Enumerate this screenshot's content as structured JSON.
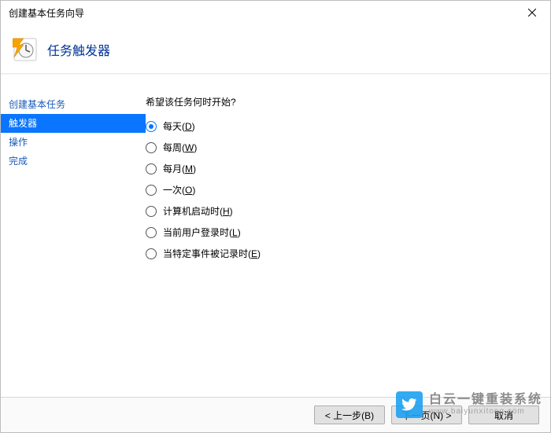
{
  "window": {
    "title": "创建基本任务向导"
  },
  "header": {
    "title": "任务触发器"
  },
  "sidebar": {
    "items": [
      {
        "label": "创建基本任务",
        "selected": false
      },
      {
        "label": "触发器",
        "selected": true
      },
      {
        "label": "操作",
        "selected": false
      },
      {
        "label": "完成",
        "selected": false
      }
    ]
  },
  "content": {
    "prompt": "希望该任务何时开始?",
    "options": [
      {
        "text": "每天",
        "accesskey": "D",
        "selected": true
      },
      {
        "text": "每周",
        "accesskey": "W",
        "selected": false
      },
      {
        "text": "每月",
        "accesskey": "M",
        "selected": false
      },
      {
        "text": "一次",
        "accesskey": "O",
        "selected": false
      },
      {
        "text": "计算机启动时",
        "accesskey": "H",
        "selected": false
      },
      {
        "text": "当前用户登录时",
        "accesskey": "L",
        "selected": false
      },
      {
        "text": "当特定事件被记录时",
        "accesskey": "E",
        "selected": false
      }
    ]
  },
  "footer": {
    "back": "< 上一步(B)",
    "next": "下一页(N) >",
    "cancel": "取消"
  },
  "watermark": {
    "line1": "白云一键重装系统",
    "line2": "www.baiyunxitong.com"
  }
}
